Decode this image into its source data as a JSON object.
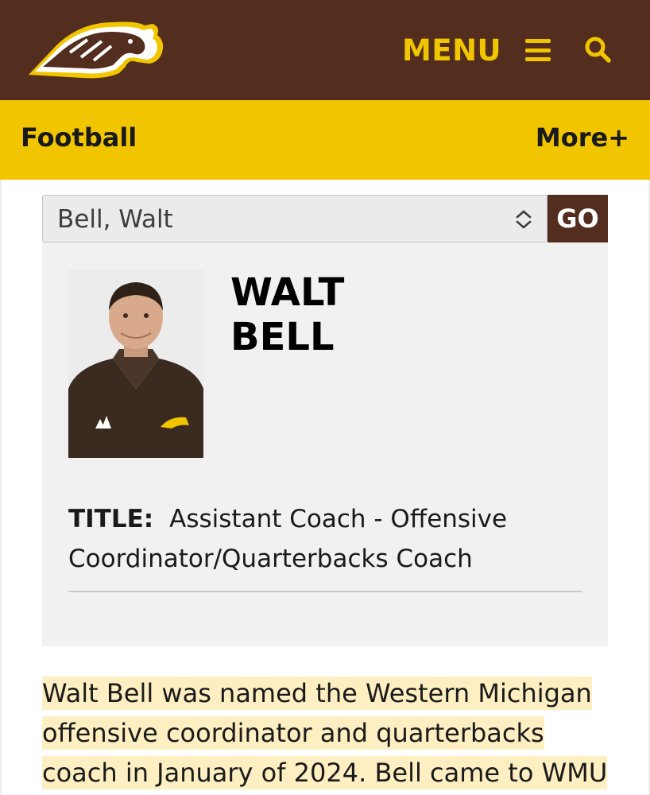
{
  "header": {
    "logo_name": "bronco-horse-logo",
    "menu_label": "MENU",
    "colors": {
      "brown": "#532e1f",
      "gold": "#f1c500"
    }
  },
  "subnav": {
    "sport": "Football",
    "more": "More+"
  },
  "roster_select": {
    "selected": "Bell, Walt",
    "go_label": "GO"
  },
  "coach": {
    "first_name": "WALT",
    "last_name": "BELL",
    "title_label": "TITLE:",
    "title_value": "Assistant Coach - Offensive Coordinator/Quarterbacks Coach"
  },
  "bio": {
    "text": "Walt Bell was named the Western Michigan offensive coordinator and quarterbacks coach in January of 2024. Bell came to WMU"
  }
}
